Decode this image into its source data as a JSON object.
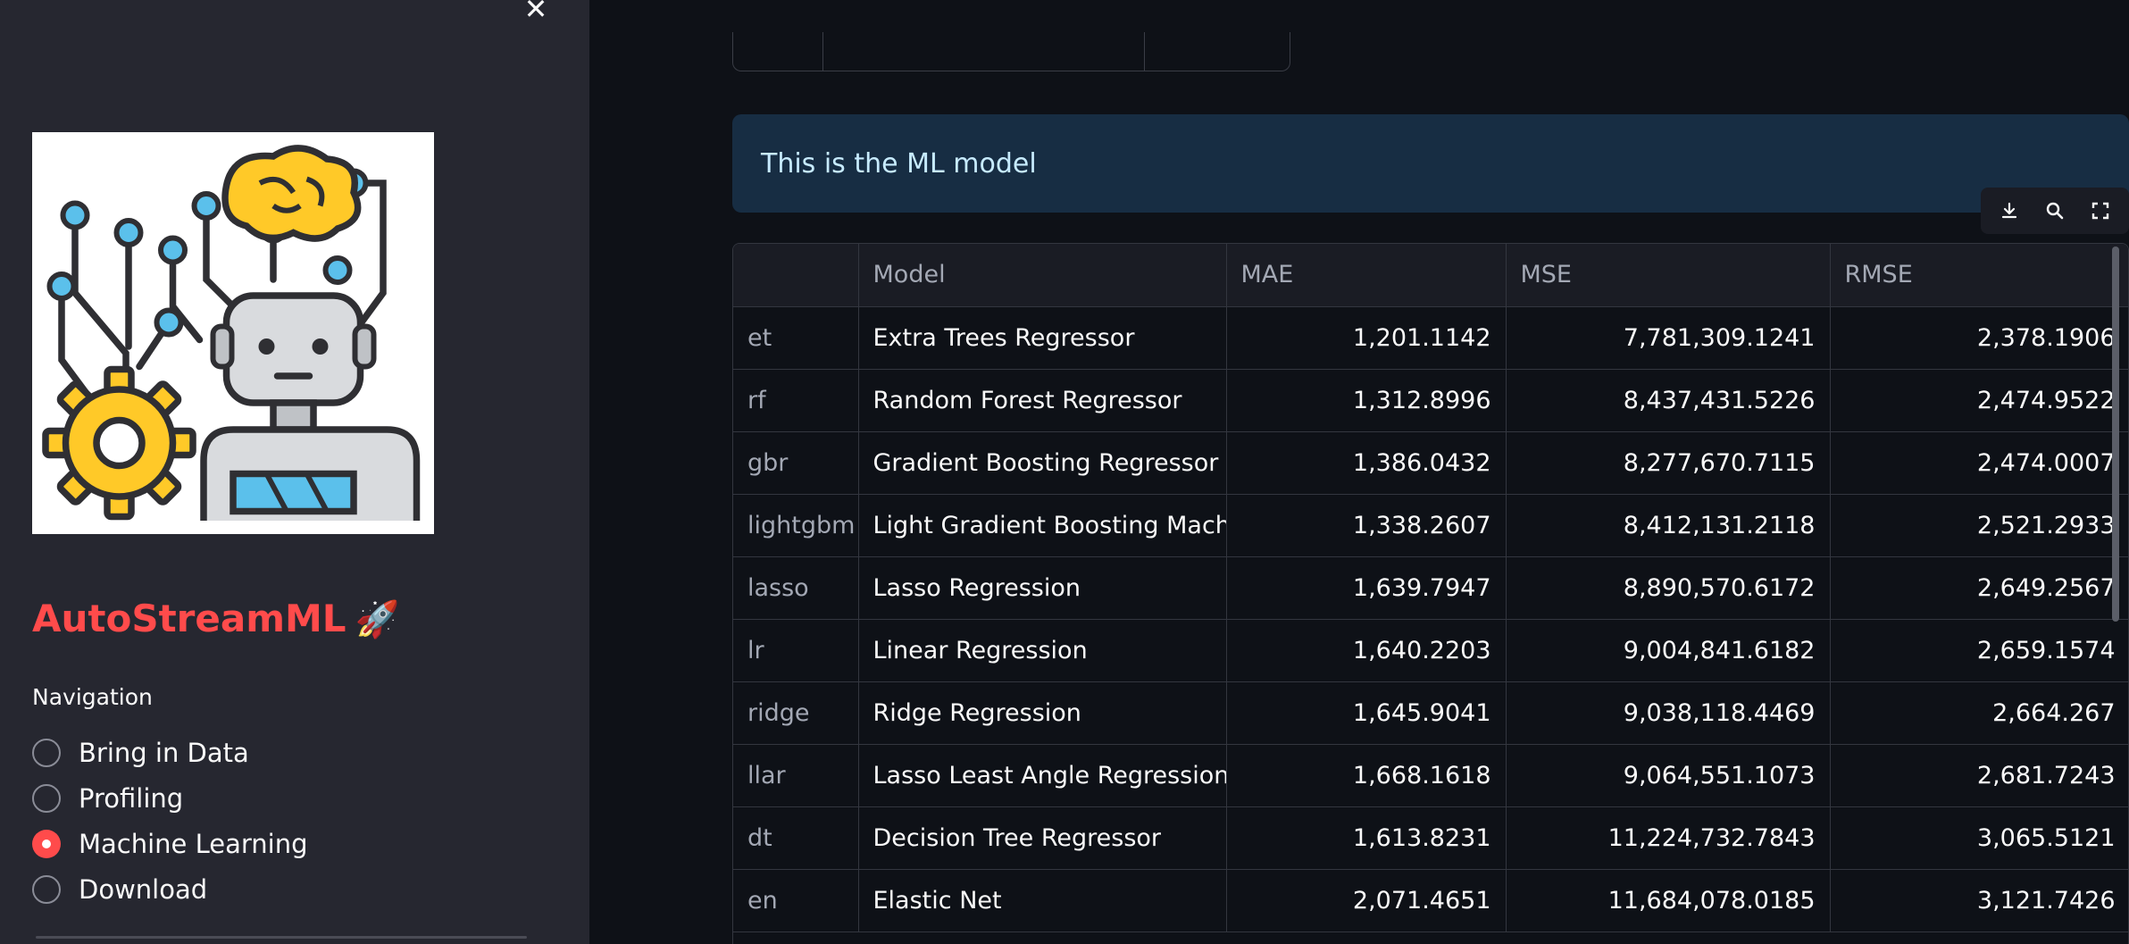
{
  "sidebar": {
    "close_icon": "close-icon",
    "logo_icon": "robot-brain-gear-logo",
    "app_title": "AutoStreamML",
    "app_title_emoji": "🚀",
    "nav_label": "Navigation",
    "nav_items": [
      {
        "label": "Bring in Data",
        "selected": false
      },
      {
        "label": "Profiling",
        "selected": false
      },
      {
        "label": "Machine Learning",
        "selected": true
      },
      {
        "label": "Download",
        "selected": false
      }
    ]
  },
  "main": {
    "info_message": "This is the ML model",
    "toolbar": {
      "download_icon": "download-icon",
      "search_icon": "search-icon",
      "fullscreen_icon": "fullscreen-icon"
    },
    "table": {
      "columns": [
        "",
        "Model",
        "MAE",
        "MSE",
        "RMSE"
      ],
      "rows": [
        [
          "et",
          "Extra Trees Regressor",
          "1,201.1142",
          "7,781,309.1241",
          "2,378.1906"
        ],
        [
          "rf",
          "Random Forest Regressor",
          "1,312.8996",
          "8,437,431.5226",
          "2,474.9522"
        ],
        [
          "gbr",
          "Gradient Boosting Regressor",
          "1,386.0432",
          "8,277,670.7115",
          "2,474.0007"
        ],
        [
          "lightgbm",
          "Light Gradient Boosting Machine",
          "1,338.2607",
          "8,412,131.2118",
          "2,521.2933"
        ],
        [
          "lasso",
          "Lasso Regression",
          "1,639.7947",
          "8,890,570.6172",
          "2,649.2567"
        ],
        [
          "lr",
          "Linear Regression",
          "1,640.2203",
          "9,004,841.6182",
          "2,659.1574"
        ],
        [
          "ridge",
          "Ridge Regression",
          "1,645.9041",
          "9,038,118.4469",
          "2,664.267"
        ],
        [
          "llar",
          "Lasso Least Angle Regression",
          "1,668.1618",
          "9,064,551.1073",
          "2,681.7243"
        ],
        [
          "dt",
          "Decision Tree Regressor",
          "1,613.8231",
          "11,224,732.7843",
          "3,065.5121"
        ],
        [
          "en",
          "Elastic Net",
          "2,071.4651",
          "11,684,078.0185",
          "3,121.7426"
        ]
      ]
    }
  },
  "colors": {
    "accent": "#ff4b4b",
    "sidebar_bg": "#262730",
    "main_bg": "#0e1117",
    "info_bg": "#172d43",
    "info_text": "#c7ebff"
  }
}
